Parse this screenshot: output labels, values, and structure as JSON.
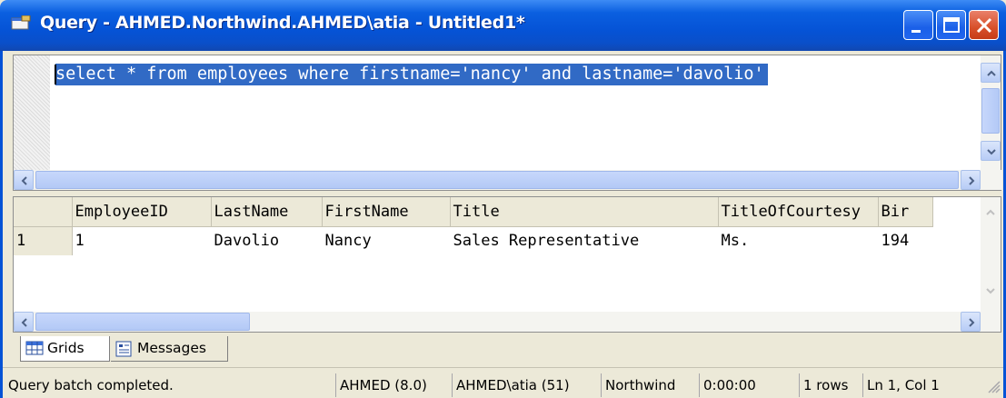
{
  "window": {
    "title": "Query - AHMED.Northwind.AHMED\\atia - Untitled1*",
    "buttons": {
      "minimize": "minimize-icon",
      "maximize": "maximize-icon",
      "close": "close-icon"
    }
  },
  "editor": {
    "sql": "select * from employees where firstname='nancy' and lastname='davolio'"
  },
  "grid": {
    "columns": [
      "EmployeeID",
      "LastName",
      "FirstName",
      "Title",
      "TitleOfCourtesy",
      "Bir"
    ],
    "rows": [
      {
        "num": "1",
        "cells": [
          "1",
          "Davolio",
          "Nancy",
          "Sales Representative",
          "Ms.",
          "194"
        ]
      }
    ]
  },
  "tabs": [
    {
      "label": "Grids",
      "icon": "grid-icon"
    },
    {
      "label": "Messages",
      "icon": "messages-icon"
    }
  ],
  "status": {
    "message": "Query batch completed.",
    "server": "AHMED (8.0)",
    "user": "AHMED\\atia (51)",
    "database": "Northwind",
    "time": "0:00:00",
    "rows": "1 rows",
    "position": "Ln 1, Col 1"
  },
  "colors": {
    "titlebar": "#0553d6",
    "selection": "#316ac5",
    "face": "#ece9d8"
  }
}
